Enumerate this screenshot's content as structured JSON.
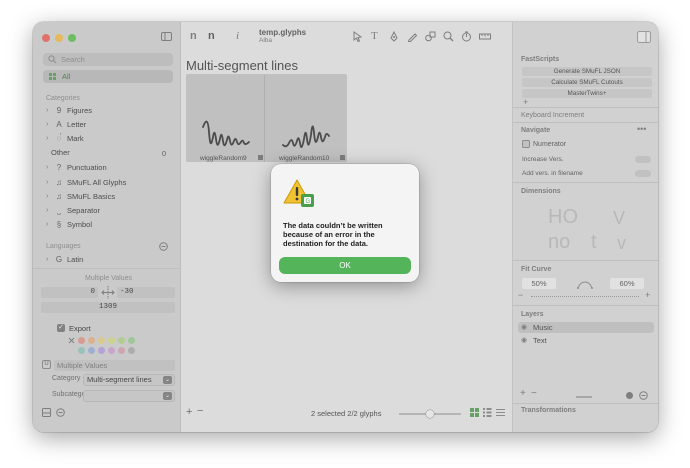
{
  "toolbar": {
    "doc_title": "temp.glyphs",
    "doc_subtitle": "Alba"
  },
  "sidebar": {
    "search_placeholder": "Search",
    "all_label": "All",
    "categories_header": "Categories",
    "categories": [
      {
        "label": "Figures",
        "icon": "9",
        "chevron": true
      },
      {
        "label": "Letter",
        "icon": "A",
        "chevron": true
      },
      {
        "label": "Mark",
        "icon": "◌́",
        "chevron": true
      },
      {
        "label": "Other",
        "icon": "",
        "chevron": false,
        "count": "0"
      },
      {
        "label": "Punctuation",
        "icon": "?",
        "chevron": true
      },
      {
        "label": "SMuFL All Glyphs",
        "icon": "♫",
        "chevron": true
      },
      {
        "label": "SMuFL Basics",
        "icon": "♫",
        "chevron": true
      },
      {
        "label": "Separator",
        "icon": "⎵",
        "chevron": true
      },
      {
        "label": "Symbol",
        "icon": "§",
        "chevron": true
      }
    ],
    "languages_header": "Languages",
    "languages": [
      {
        "label": "Latin",
        "icon": "G"
      }
    ],
    "multiple_values_header": "Multiple Values",
    "metric_left": "0",
    "metric_right": "-30",
    "metric_width": "1309",
    "export_label": "Export",
    "unicode_badge": "U",
    "unicode_value": "Multiple Values",
    "category_label": "Category",
    "category_value": "Multi-segment lines",
    "subcategory_label": "Subcategory",
    "subcategory_value": "",
    "swatch_colors": [
      "#e39c8c",
      "#e6b88a",
      "#e8d48a",
      "#d6df8a",
      "#b7d78e",
      "#9fcf96",
      "#97c8c0",
      "#9fb2df",
      "#b7a3de",
      "#d2a6d6",
      "#d7a6b6",
      "#b0b0b0"
    ]
  },
  "main": {
    "title": "Multi-segment lines",
    "glyphs": [
      {
        "name": "wiggleRandom9"
      },
      {
        "name": "wiggleRandom10"
      }
    ],
    "status": "2 selected 2/2 glyphs"
  },
  "right": {
    "fastscripts_header": "FastScripts",
    "fastscripts": [
      "Generate SMuFL JSON",
      "Calculate SMuFL Cutouts",
      "MasterTwins+"
    ],
    "keyboard_increment": "Keyboard Increment",
    "navigate_header": "Navigate",
    "numerator_label": "Numerator",
    "increase_vers_label": "Increase Vers.",
    "add_vers_label": "Add vers. in filename",
    "dimensions_header": "Dimensions",
    "dim_letters": [
      "HO",
      "V",
      "no",
      "t",
      "v"
    ],
    "fit_curve_header": "Fit Curve",
    "fit_curve_min": "50%",
    "fit_curve_max": "60%",
    "layers_header": "Layers",
    "layers": [
      {
        "label": "Music",
        "selected": true
      },
      {
        "label": "Text",
        "selected": false
      }
    ],
    "transformations_header": "Transformations"
  },
  "dialog": {
    "message": "The data couldn’t be written because of an error in the destination for the data.",
    "ok_label": "OK"
  }
}
